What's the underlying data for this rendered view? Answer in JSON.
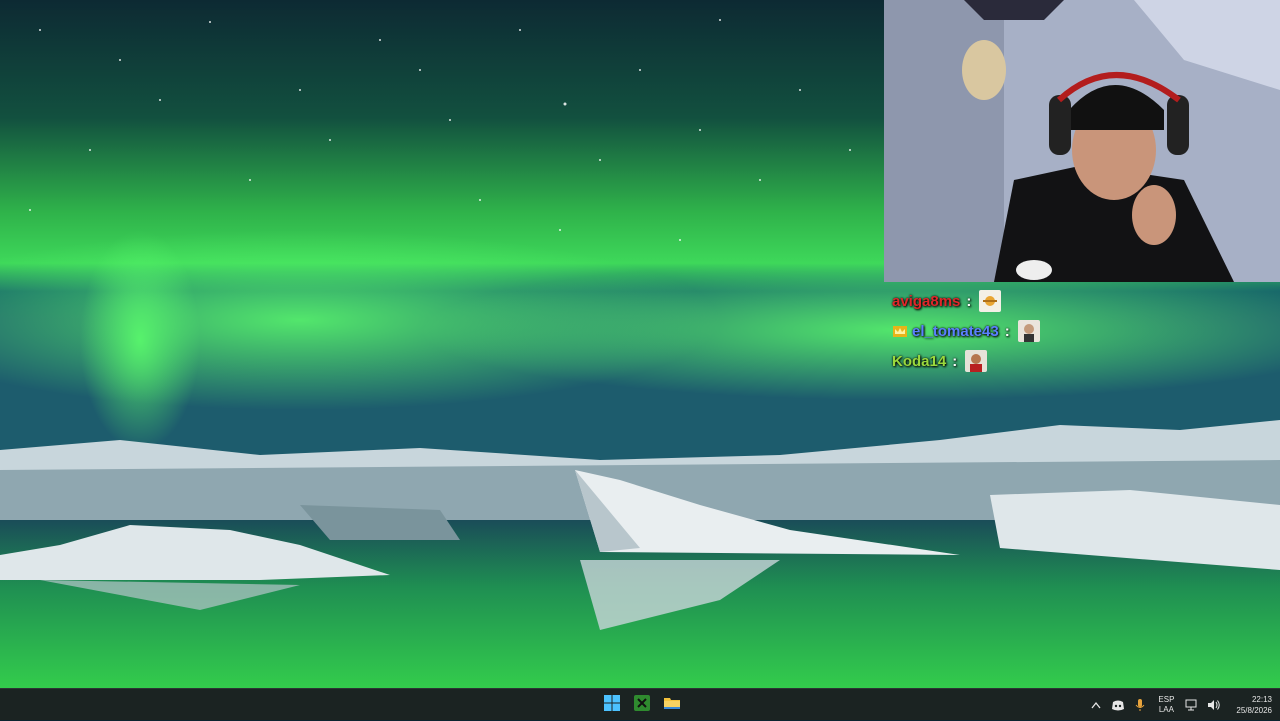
{
  "wallpaper": {
    "description_icon": "northern-lights-glacier-lagoon"
  },
  "chat": {
    "messages": [
      {
        "username": "aviga8ms",
        "color": "#e0262a",
        "has_badge": false,
        "emote": "emote-1"
      },
      {
        "username": "el_tomate43",
        "color": "#5b7fff",
        "has_badge": true,
        "emote": "emote-2"
      },
      {
        "username": "Koda14",
        "color": "#9ad93d",
        "has_badge": false,
        "emote": "emote-3"
      }
    ],
    "separator": ":"
  },
  "taskbar": {
    "apps": [
      {
        "name": "windows-start",
        "icon": "windows-logo-icon"
      },
      {
        "name": "xbox-app",
        "icon": "xbox-icon"
      },
      {
        "name": "file-explorer",
        "icon": "folder-icon"
      }
    ],
    "tray": {
      "overflow": "chevron-up-icon",
      "lang_top": "ESP",
      "lang_bottom": "LAA",
      "time": "22:13",
      "date": "25/8/2026"
    }
  },
  "colors": {
    "aurora": "#39e05a",
    "taskbar_bg": "#1b2322"
  }
}
